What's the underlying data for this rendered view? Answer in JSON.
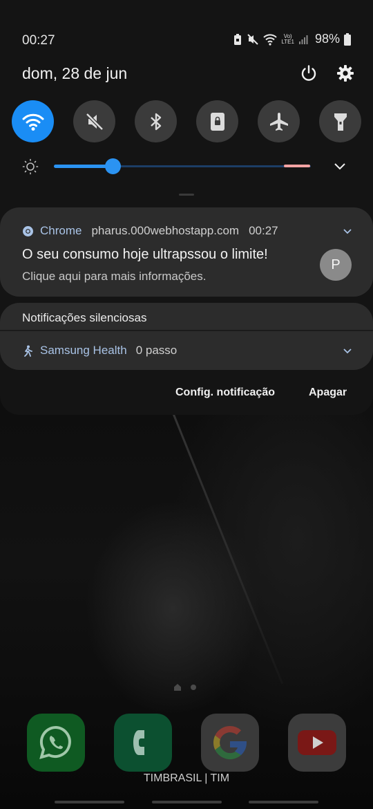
{
  "status_bar": {
    "time": "00:27",
    "network_label_top": "Vo)",
    "network_label_bottom": "LTE1",
    "battery": "98%"
  },
  "header": {
    "date": "dom, 28 de jun",
    "power_icon": "power-icon",
    "settings_icon": "gear-icon"
  },
  "quick_settings": [
    {
      "name": "wifi",
      "icon": "wifi-icon",
      "state": "on"
    },
    {
      "name": "sound",
      "icon": "mute-icon",
      "state": "off"
    },
    {
      "name": "bluetooth",
      "icon": "bluetooth-icon",
      "state": "off"
    },
    {
      "name": "lock-rotation",
      "icon": "portrait-lock-icon",
      "state": "off"
    },
    {
      "name": "airplane",
      "icon": "airplane-icon",
      "state": "off"
    },
    {
      "name": "flashlight",
      "icon": "flashlight-icon",
      "state": "off"
    }
  ],
  "brightness": {
    "level": 0.23
  },
  "notification": {
    "app": "Chrome",
    "domain": "pharus.000webhostapp.com",
    "time": "00:27",
    "title": "O seu consumo hoje ultrapssou o limite!",
    "text": "Clique aqui para mais informações.",
    "avatar_letter": "P"
  },
  "silent": {
    "header": "Notificações silenciosas",
    "app": "Samsung Health",
    "steps": "0 passo"
  },
  "actions": {
    "settings_label": "Config. notificação",
    "clear_label": "Apagar"
  },
  "dock": {
    "apps": [
      "WhatsApp",
      "Phone",
      "Google",
      "YouTube"
    ],
    "carrier": "TIMBRASIL | TIM"
  },
  "colors": {
    "accent": "#1a8df5",
    "shade": "#141414",
    "card": "#2c2c2c",
    "app_name": "#a9c3e6"
  }
}
